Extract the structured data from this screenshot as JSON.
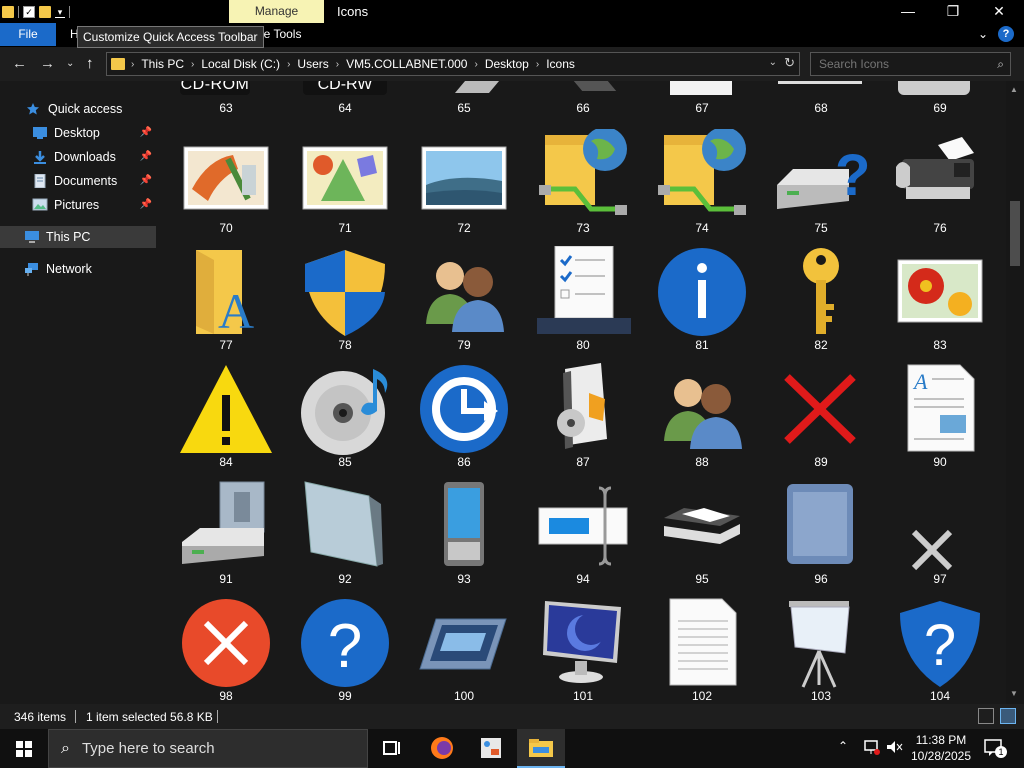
{
  "titlebar": {
    "manage_label": "Manage",
    "window_title": "Icons",
    "minimize": "—",
    "maximize": "❐",
    "close": "✕"
  },
  "ribbon": {
    "file_label": "File",
    "home_label": "H",
    "picture_tools_label": "icture Tools",
    "tooltip": "Customize Quick Access Toolbar",
    "expand": "⌄",
    "help": "?"
  },
  "address": {
    "crumbs": [
      "This PC",
      "Local Disk (C:)",
      "Users",
      "VM5.COLLABNET.000",
      "Desktop",
      "Icons"
    ],
    "search_placeholder": "Search Icons"
  },
  "navpane": {
    "items": [
      {
        "label": "Quick access",
        "icon": "star-icon"
      },
      {
        "label": "Desktop",
        "icon": "desktop-icon",
        "pinned": true
      },
      {
        "label": "Downloads",
        "icon": "download-icon",
        "pinned": true
      },
      {
        "label": "Documents",
        "icon": "documents-icon",
        "pinned": true
      },
      {
        "label": "Pictures",
        "icon": "pictures-icon",
        "pinned": true
      },
      {
        "label": "This PC",
        "icon": "computer-icon",
        "selected": true
      },
      {
        "label": "Network",
        "icon": "network-icon"
      }
    ]
  },
  "icons": {
    "top_row_labels": [
      "63",
      "64",
      "65",
      "66",
      "67",
      "68",
      "69"
    ],
    "top_row_captions": [
      "CD-ROM",
      "CD-RW"
    ],
    "rows": [
      [
        "70",
        "71",
        "72",
        "73",
        "74",
        "75",
        "76"
      ],
      [
        "77",
        "78",
        "79",
        "80",
        "81",
        "82",
        "83"
      ],
      [
        "84",
        "85",
        "86",
        "87",
        "88",
        "89",
        "90"
      ],
      [
        "91",
        "92",
        "93",
        "94",
        "95",
        "96",
        "97"
      ],
      [
        "98",
        "99",
        "100",
        "101",
        "102",
        "103",
        "104"
      ]
    ]
  },
  "status": {
    "item_count": "346 items",
    "selection": "1 item selected  56.8 KB"
  },
  "taskbar": {
    "search_placeholder": "Type here to search",
    "time": "11:38 PM",
    "date": "10/28/2025",
    "notification_count": "1"
  }
}
